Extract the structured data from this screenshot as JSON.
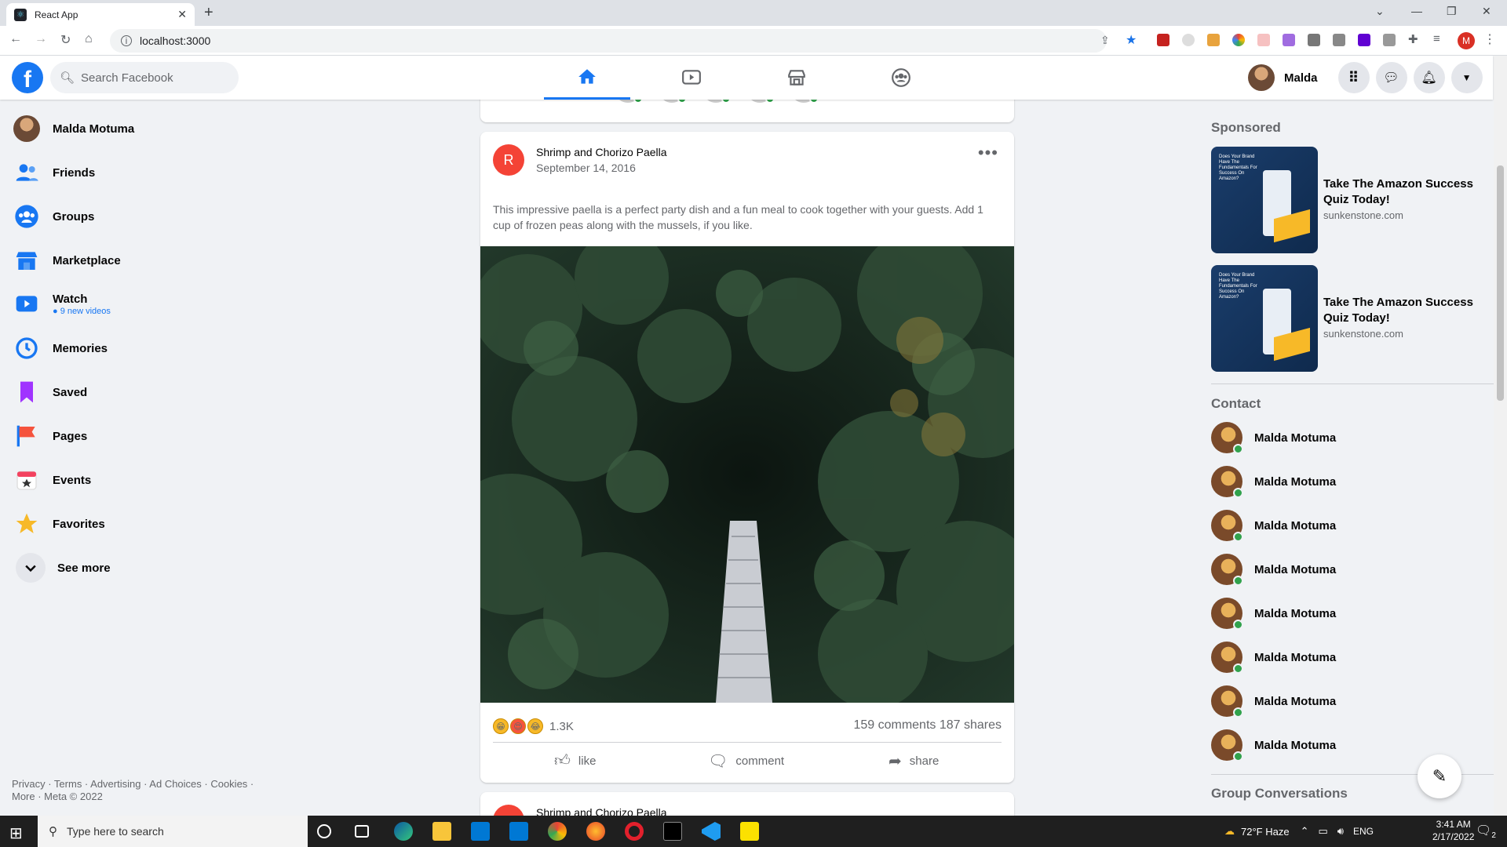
{
  "browser": {
    "tab_title": "React App",
    "url": "localhost:3000",
    "profile_initial": "M"
  },
  "header": {
    "search_placeholder": "Search Facebook",
    "user_name": "Malda",
    "center_tabs": [
      "home-icon",
      "watch-icon",
      "marketplace-icon",
      "groups-icon"
    ]
  },
  "sidebar": {
    "items": [
      {
        "label": "Malda Motuma",
        "icon": "avatar"
      },
      {
        "label": "Friends",
        "icon": "friends-icon"
      },
      {
        "label": "Groups",
        "icon": "groups-icon"
      },
      {
        "label": "Marketplace",
        "icon": "marketplace-icon"
      },
      {
        "label": "Watch",
        "icon": "watch-icon",
        "sub": "9 new videos"
      },
      {
        "label": "Memories",
        "icon": "memories-icon"
      },
      {
        "label": "Saved",
        "icon": "saved-icon"
      },
      {
        "label": "Pages",
        "icon": "pages-icon"
      },
      {
        "label": "Events",
        "icon": "events-icon"
      },
      {
        "label": "Favorites",
        "icon": "favorites-icon"
      },
      {
        "label": "See more",
        "icon": "chevron-down-icon"
      }
    ],
    "footer": "Privacy · Terms · Advertising · Ad Choices · Cookies · More · Meta © 2022"
  },
  "post": {
    "avatar_letter": "R",
    "title": "Shrimp and Chorizo Paella",
    "date": "September 14, 2016",
    "text": "This impressive paella is a perfect party dish and a fun meal to cook together with your guests. Add 1 cup of frozen peas along with the mussels, if you like.",
    "reaction_count": "1.3K",
    "counts": "159 comments 187 shares",
    "actions": {
      "like": "like",
      "comment": "comment",
      "share": "share"
    }
  },
  "post2": {
    "title": "Shrimp and Chorizo Paella"
  },
  "right": {
    "sponsored_title": "Sponsored",
    "ads": [
      {
        "title": "Take The Amazon Success Quiz Today!",
        "url": "sunkenstone.com",
        "image_text": "Does Your Brand Have The Fundamentals For Success On Amazon?"
      },
      {
        "title": "Take The Amazon Success Quiz Today!",
        "url": "sunkenstone.com",
        "image_text": "Does Your Brand Have The Fundamentals For Success On Amazon?"
      }
    ],
    "contact_title": "Contact",
    "contacts": [
      "Malda Motuma",
      "Malda Motuma",
      "Malda Motuma",
      "Malda Motuma",
      "Malda Motuma",
      "Malda Motuma",
      "Malda Motuma",
      "Malda Motuma"
    ],
    "group_title": "Group Conversations"
  },
  "taskbar": {
    "search_placeholder": "Type here to search",
    "weather": "72°F  Haze",
    "lang": "ENG",
    "time": "3:41 AM",
    "date": "2/17/2022",
    "notifications": "2"
  },
  "colors": {
    "accent": "#1877f2",
    "online": "#31a24c",
    "avatar_red": "#f44336"
  }
}
